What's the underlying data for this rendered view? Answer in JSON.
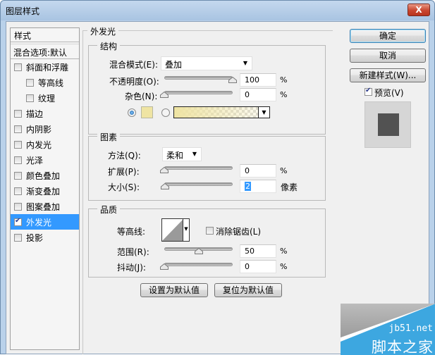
{
  "window": {
    "title": "图层样式",
    "close_label": "X"
  },
  "style_list": {
    "header": "样式",
    "blend_options": "混合选项:默认",
    "items": [
      {
        "label": "斜面和浮雕",
        "checked": false,
        "sub": false
      },
      {
        "label": "等高线",
        "checked": false,
        "sub": true
      },
      {
        "label": "纹理",
        "checked": false,
        "sub": true
      },
      {
        "label": "描边",
        "checked": false,
        "sub": false
      },
      {
        "label": "内阴影",
        "checked": false,
        "sub": false
      },
      {
        "label": "内发光",
        "checked": false,
        "sub": false
      },
      {
        "label": "光泽",
        "checked": false,
        "sub": false
      },
      {
        "label": "颜色叠加",
        "checked": false,
        "sub": false
      },
      {
        "label": "渐变叠加",
        "checked": false,
        "sub": false
      },
      {
        "label": "图案叠加",
        "checked": false,
        "sub": false
      },
      {
        "label": "外发光",
        "checked": true,
        "sub": false,
        "active": true
      },
      {
        "label": "投影",
        "checked": false,
        "sub": false
      }
    ]
  },
  "panel": {
    "title": "外发光",
    "structure": {
      "title": "结构",
      "blend_mode_label": "混合模式(E):",
      "blend_mode_value": "叠加",
      "opacity_label": "不透明度(O):",
      "opacity_value": "100",
      "opacity_unit": "%",
      "opacity_fraction": 1.0,
      "noise_label": "杂色(N):",
      "noise_value": "0",
      "noise_unit": "%",
      "noise_fraction": 0.0,
      "color_mode": "solid",
      "glow_color": "#efe4a3"
    },
    "elements": {
      "title": "图素",
      "technique_label": "方法(Q):",
      "technique_value": "柔和",
      "spread_label": "扩展(P):",
      "spread_value": "0",
      "spread_unit": "%",
      "spread_fraction": 0.0,
      "size_label": "大小(S):",
      "size_value": "2",
      "size_unit": "像素",
      "size_fraction": 0.01
    },
    "quality": {
      "title": "品质",
      "contour_label": "等高线:",
      "anti_alias_label": "消除锯齿(L)",
      "anti_alias_checked": false,
      "range_label": "范围(R):",
      "range_value": "50",
      "range_unit": "%",
      "range_fraction": 0.5,
      "jitter_label": "抖动(J):",
      "jitter_value": "0",
      "jitter_unit": "%",
      "jitter_fraction": 0.0
    },
    "make_default_label": "设置为默认值",
    "reset_default_label": "复位为默认值"
  },
  "actions": {
    "ok_label": "确定",
    "cancel_label": "取消",
    "new_style_label": "新建样式(W)...",
    "preview_label": "预览(V)",
    "preview_checked": true
  },
  "watermark": {
    "url": "jb51.net",
    "name": "脚本之家"
  }
}
